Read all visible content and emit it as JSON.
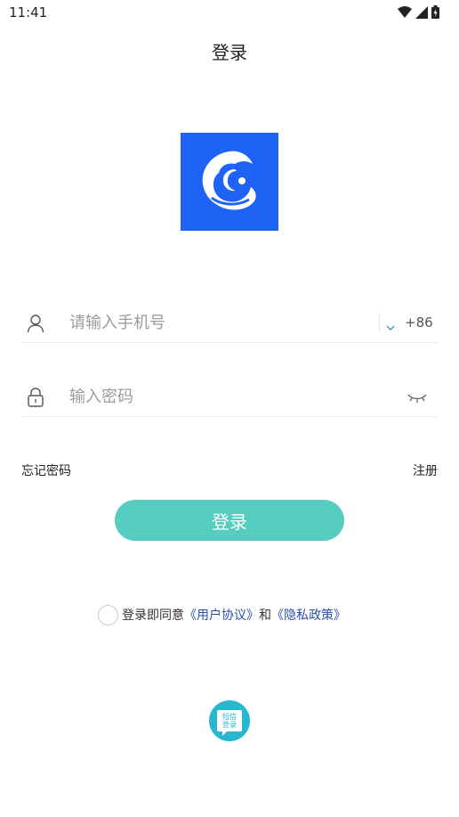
{
  "status_bar": {
    "time": "11:41",
    "icons": [
      "wifi-icon",
      "cell-signal-icon",
      "battery-icon"
    ]
  },
  "header": {
    "title": "登录"
  },
  "logo": {
    "icon": "app-logo-icon",
    "background_color": "#1e63f5"
  },
  "form": {
    "phone": {
      "icon": "user-icon",
      "value": "",
      "placeholder": "请输入手机号",
      "country_code": "+86"
    },
    "password": {
      "icon": "lock-icon",
      "value": "",
      "placeholder": "输入密码",
      "toggle_icon": "eye-closed-icon"
    }
  },
  "links": {
    "forgot_password": "忘记密码",
    "register": "注册"
  },
  "login_button": {
    "label": "登录",
    "color": "#57ccc0"
  },
  "agreement": {
    "checked": false,
    "prefix": "登录即同意",
    "user_agreement": "《用户协议》",
    "conjunction": "和",
    "privacy_policy": "《隐私政策》",
    "link_color": "#2d4ea8"
  },
  "sms_login": {
    "line1": "短信",
    "line2": "登录",
    "color": "#27b7cf"
  }
}
